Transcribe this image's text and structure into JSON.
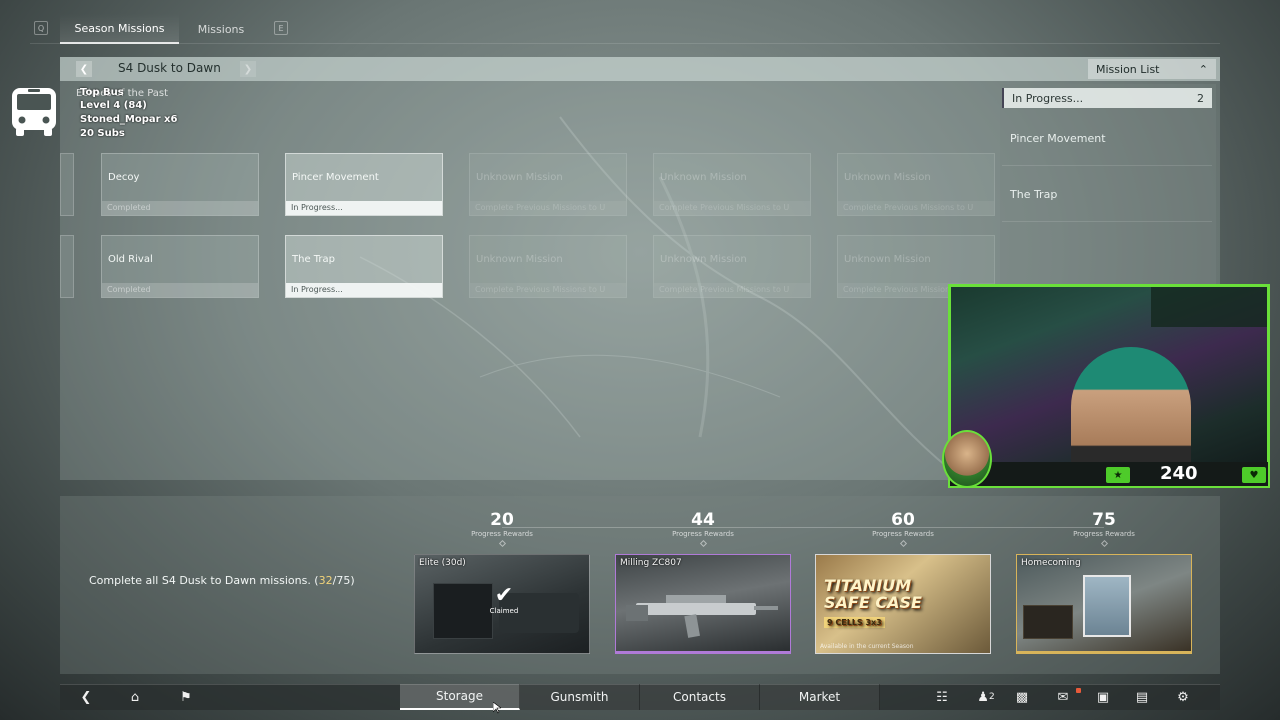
{
  "tabs": {
    "left_key": "Q",
    "right_key": "E",
    "items": [
      {
        "label": "Season Missions",
        "active": true
      },
      {
        "label": "Missions",
        "active": false
      }
    ]
  },
  "season": {
    "title": "S4 Dusk to Dawn"
  },
  "mission_list": {
    "header": "Mission List",
    "filter_label": "In Progress...",
    "filter_count": "2",
    "items": [
      "Pincer Movement",
      "The Trap"
    ]
  },
  "overlay": {
    "lines": [
      "Top Bus",
      "Level 4  (84)",
      "Stoned_Mopar x6",
      "20 Subs"
    ],
    "behind_text": "Echoes of the Past"
  },
  "missions": {
    "row1": [
      {
        "name": "Decoy",
        "status": "Completed",
        "state": "completed"
      },
      {
        "name": "Pincer Movement",
        "status": "In Progress...",
        "state": "progress"
      },
      {
        "name": "Unknown Mission",
        "status": "Complete Previous Missions to U",
        "state": "locked"
      },
      {
        "name": "Unknown Mission",
        "status": "Complete Previous Missions to U",
        "state": "locked"
      },
      {
        "name": "Unknown Mission",
        "status": "Complete Previous Missions to U",
        "state": "locked"
      }
    ],
    "row2": [
      {
        "name": "Old Rival",
        "status": "Completed",
        "state": "completed"
      },
      {
        "name": "The Trap",
        "status": "In Progress...",
        "state": "progress"
      },
      {
        "name": "Unknown Mission",
        "status": "Complete Previous Missions to U",
        "state": "locked"
      },
      {
        "name": "Unknown Mission",
        "status": "Complete Previous Missions to U",
        "state": "locked"
      },
      {
        "name": "Unknown Mission",
        "status": "Complete Previous Missions to U",
        "state": "locked"
      }
    ]
  },
  "webcam": {
    "counter": "240"
  },
  "rewards": {
    "requirement_prefix": "Complete all S4 Dusk to Dawn missions. (",
    "requirement_current": "32",
    "requirement_suffix": "/75)",
    "tiers": [
      {
        "value": "20",
        "label": "Progress Rewards"
      },
      {
        "value": "44",
        "label": "Progress Rewards"
      },
      {
        "value": "60",
        "label": "Progress Rewards"
      },
      {
        "value": "75",
        "label": "Progress Rewards"
      }
    ],
    "items": [
      {
        "name": "Elite (30d)",
        "claimed_label": "Claimed"
      },
      {
        "name": "Milling ZC807"
      },
      {
        "name": "",
        "art_title": "TITANIUM SAFE CASE",
        "art_sub": "9 CELLS 3x3",
        "note": "Available in the current Season"
      },
      {
        "name": "Homecoming"
      }
    ]
  },
  "bottom_nav": {
    "buttons": [
      "Storage",
      "Gunsmith",
      "Contacts",
      "Market"
    ],
    "squad_count": "2"
  },
  "colors": {
    "accent_green": "#6ae03a",
    "claimed_gold": "#f0d27a",
    "purple_rarity": "#b07ad8",
    "gold_rarity": "#d8b45a"
  }
}
